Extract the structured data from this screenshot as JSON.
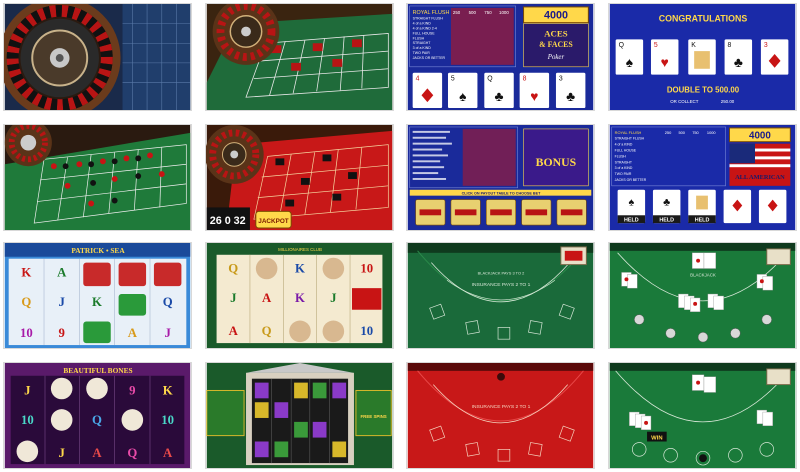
{
  "tiles": {
    "video_poker_3": {
      "pay_header": [
        "250",
        "500",
        "750",
        "1000"
      ],
      "hands": [
        "ROYAL FLUSH",
        "STRAIGHT FLUSH",
        "4 of a KIND",
        "4 of a KIND 2-4",
        "FULL HOUSE",
        "FLUSH",
        "STRAIGHT",
        "3 of a KIND",
        "TWO PAIR",
        "JACKS OR BETTER"
      ],
      "win_amount": "4000",
      "logo_line1": "ACES",
      "logo_line2": "& FACES",
      "logo_line3": "Poker",
      "cards": [
        "4",
        "5",
        "Q",
        "8",
        "3"
      ]
    },
    "double_up": {
      "title": "CONGRATULATIONS",
      "double_text": "DOUBLE TO 500.00",
      "collect_label": "OR COLLECT",
      "collect_amount": "250.00",
      "cards": [
        "Q",
        "5",
        "K",
        "8",
        "3"
      ]
    },
    "roulette_red": {
      "history": "26 0 32",
      "jackpot_label": "JACKPOT"
    },
    "bonus_poker": {
      "logo_text": "BONUS",
      "banner": "CLICK ON PAYOUT TABLE TO CHOOSE BET",
      "held_labels": [
        "",
        "",
        "",
        "",
        ""
      ]
    },
    "all_american": {
      "win_amount": "4000",
      "logo_text": "ALL AMERICAN",
      "pay_header": [
        "250",
        "500",
        "750",
        "1000"
      ],
      "hands": [
        "ROYAL FLUSH",
        "STRAIGHT FLUSH",
        "4 of a KIND",
        "FULL HOUSE",
        "FLUSH",
        "STRAIGHT",
        "3 of a KIND",
        "TWO PAIR",
        "JACKS OR BETTER"
      ],
      "held_labels": [
        "HELD",
        "HELD",
        "HELD",
        "",
        ""
      ]
    },
    "slot_sea": {
      "title": "PATRICK • SEA",
      "symbols": [
        "K",
        "A",
        "Q",
        "J",
        "10",
        "9",
        "K",
        "A",
        "Q",
        "J"
      ]
    },
    "slot_millionaires": {
      "title": "MILLIONAIRES CLUB",
      "symbols": [
        "Q",
        "J",
        "K",
        "10",
        "A",
        "Q",
        "J",
        "10",
        "K",
        "A"
      ]
    },
    "blackjack_green_1": {
      "table_text": "INSURANCE PAYS 2 TO 1",
      "rule_text": "BLACKJACK PAYS 3 TO 2"
    },
    "blackjack_green_2": {
      "table_text": "BLACKJACK"
    },
    "slot_bones": {
      "title": "BEAUTIFUL BONES",
      "symbols": [
        "J",
        "10",
        "9",
        "K",
        "Q",
        "A",
        "J",
        "10",
        "Q",
        "A"
      ]
    },
    "slot_temple": {
      "jackpot_label": "FREE SPINS"
    },
    "blackjack_red": {
      "table_text": "INSURANCE PAYS 2 TO 1"
    },
    "blackjack_green_3": {
      "win_label": "WIN"
    }
  }
}
